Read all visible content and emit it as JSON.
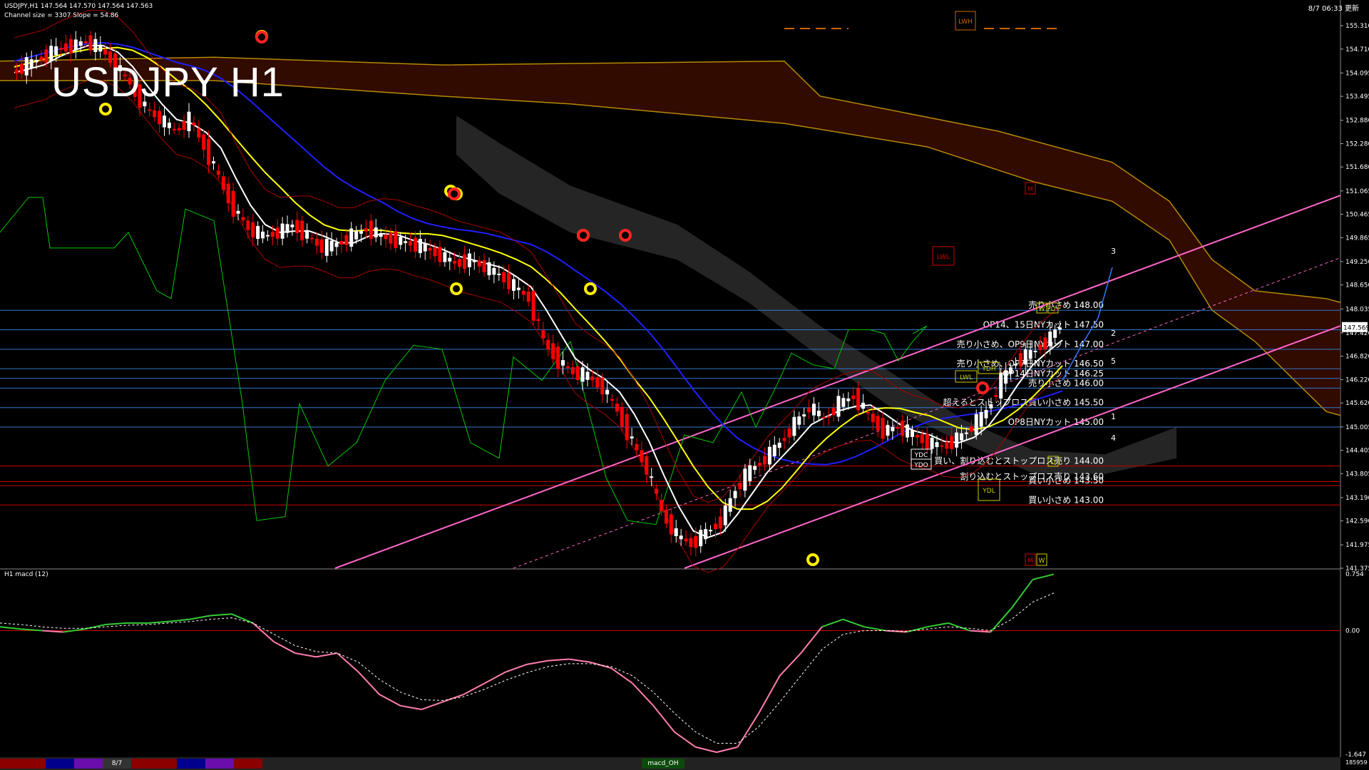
{
  "header": {
    "symbol_line": "USDJPY,H1  147.564 147.570 147.564 147.563",
    "channel_line": "Channel size = 3307 Slope = 54.86",
    "big_title": "USDJPY H1",
    "datetime": "8/7 06:33 更新"
  },
  "macd_label": "H1  macd (12)",
  "bottom_tabs": [
    {
      "label": "",
      "color": "#8b0000"
    },
    {
      "label": "",
      "color": "#00008b"
    },
    {
      "label": "",
      "color": "#6a0dad"
    },
    {
      "label": "8/7",
      "color": "#333333"
    },
    {
      "label": "",
      "color": "#8b0000"
    },
    {
      "label": "",
      "color": "#00008b"
    },
    {
      "label": "",
      "color": "#6a0dad"
    },
    {
      "label": "",
      "color": "#8b0000"
    },
    {
      "label": "macd_OH",
      "color": "#0b4a0b"
    }
  ],
  "colors": {
    "bull_candle": "#ffffff",
    "bear_candle": "#ff0000",
    "ma_white": "#ffffff",
    "ma_yellow": "#ffff00",
    "ma_blue": "#1f1fff",
    "chikou": "#00c800",
    "channel": "#ff66cc",
    "kumo_red": "#cc3300",
    "kumo_white": "#cccccc",
    "resistance_line": "#3377cc",
    "support_line": "#cc0000",
    "macd_main": "#33cc33",
    "macd_signal": "#ffffff"
  },
  "chart_data": [
    {
      "type": "candlestick",
      "title": "USDJPY H1",
      "ylim": [
        141.375,
        155.31
      ],
      "y_ticks": [
        155.31,
        154.71,
        154.095,
        153.495,
        152.88,
        152.28,
        151.68,
        151.065,
        150.465,
        149.865,
        149.25,
        148.65,
        148.035,
        147.42,
        146.82,
        146.22,
        145.62,
        145.005,
        144.405,
        143.805,
        143.19,
        142.59,
        141.975,
        141.375
      ],
      "current_price": "147.569",
      "close_path": [
        154.1,
        154.3,
        154.5,
        154.7,
        154.8,
        154.9,
        154.7,
        154.3,
        153.8,
        153.2,
        152.9,
        152.6,
        152.9,
        152.2,
        151.4,
        150.6,
        150.1,
        149.9,
        150.0,
        150.2,
        149.9,
        149.6,
        149.7,
        149.9,
        150.1,
        149.9,
        149.8,
        149.7,
        149.6,
        149.4,
        149.2,
        149.3,
        149.1,
        148.9,
        148.6,
        148.3,
        147.2,
        146.7,
        146.4,
        146.3,
        146.0,
        145.4,
        144.6,
        143.9,
        142.8,
        142.2,
        142.0,
        142.3,
        142.6,
        143.4,
        143.9,
        144.2,
        144.6,
        145.1,
        145.5,
        145.2,
        145.6,
        145.8,
        145.3,
        144.9,
        145.0,
        144.8,
        144.6,
        144.5,
        144.7,
        145.0,
        145.4,
        146.2,
        146.7,
        146.9,
        147.2,
        147.6
      ],
      "level_lines": [
        {
          "price": 148.0,
          "text": "売り小さめ 148.00",
          "color": "#3377cc"
        },
        {
          "price": 147.5,
          "text": "OP14、15日NYカット 147.50",
          "color": "#3377cc"
        },
        {
          "price": 147.0,
          "text": "売り小さめ、OP9日NYカット 147.00",
          "color": "#3377cc"
        },
        {
          "price": 146.5,
          "text": "売り小さめ、OP7日NYカット 146.50",
          "color": "#3377cc"
        },
        {
          "price": 146.25,
          "text": "OP14日NYカット 146.25",
          "color": "#3377cc"
        },
        {
          "price": 146.0,
          "text": "売り小さめ 146.00",
          "color": "#3377cc"
        },
        {
          "price": 145.5,
          "text": "超えるとストップロス買い小さめ 145.50",
          "color": "#3377cc"
        },
        {
          "price": 145.0,
          "text": "OP8日NYカット 145.00",
          "color": "#3377cc"
        },
        {
          "price": 144.0,
          "text": "買い、割り込むとストップロス売り 144.00",
          "color": "#cc0000"
        },
        {
          "price": 143.6,
          "text": "割り込むとストップロス売り 143.60",
          "color": "#cc0000"
        },
        {
          "price": 143.5,
          "text": "買い小さめ 143.50",
          "color": "#cc0000"
        },
        {
          "price": 143.0,
          "text": "買い小さめ 143.00",
          "color": "#cc0000"
        }
      ],
      "box_labels": [
        "LWH",
        "LWL",
        "YDH",
        "LWL",
        "YDC",
        "YDO",
        "YDL",
        "D",
        "D",
        "M",
        "M",
        "W",
        "W"
      ],
      "wave_labels": [
        "1",
        "2",
        "3",
        "4",
        "5"
      ]
    },
    {
      "type": "line",
      "title": "H1 macd (12)",
      "ylim": [
        -1.647,
        0.754
      ],
      "y_ticks": [
        0.754,
        0.0,
        -1.647
      ],
      "y_tick_labels": [
        "0.754",
        "0.00",
        "-1.647"
      ],
      "bottom_value": "185959",
      "macd": [
        0.05,
        0.02,
        0.0,
        -0.02,
        0.02,
        0.08,
        0.1,
        0.1,
        0.12,
        0.15,
        0.2,
        0.22,
        0.1,
        -0.15,
        -0.3,
        -0.35,
        -0.3,
        -0.55,
        -0.85,
        -1.0,
        -1.05,
        -0.95,
        -0.85,
        -0.7,
        -0.55,
        -0.45,
        -0.4,
        -0.38,
        -0.42,
        -0.5,
        -0.7,
        -1.0,
        -1.35,
        -1.55,
        -1.62,
        -1.55,
        -1.1,
        -0.6,
        -0.3,
        0.05,
        0.15,
        0.05,
        0.0,
        -0.02,
        0.05,
        0.1,
        0.0,
        -0.02,
        0.3,
        0.68,
        0.75
      ],
      "signal": [
        0.1,
        0.08,
        0.05,
        0.03,
        0.03,
        0.05,
        0.07,
        0.08,
        0.1,
        0.12,
        0.15,
        0.17,
        0.1,
        -0.05,
        -0.2,
        -0.28,
        -0.3,
        -0.42,
        -0.65,
        -0.82,
        -0.92,
        -0.93,
        -0.88,
        -0.78,
        -0.66,
        -0.56,
        -0.48,
        -0.44,
        -0.44,
        -0.48,
        -0.6,
        -0.82,
        -1.1,
        -1.35,
        -1.5,
        -1.5,
        -1.28,
        -0.95,
        -0.6,
        -0.25,
        -0.05,
        0.0,
        0.0,
        -0.01,
        0.02,
        0.05,
        0.03,
        0.0,
        0.15,
        0.38,
        0.5
      ]
    }
  ]
}
